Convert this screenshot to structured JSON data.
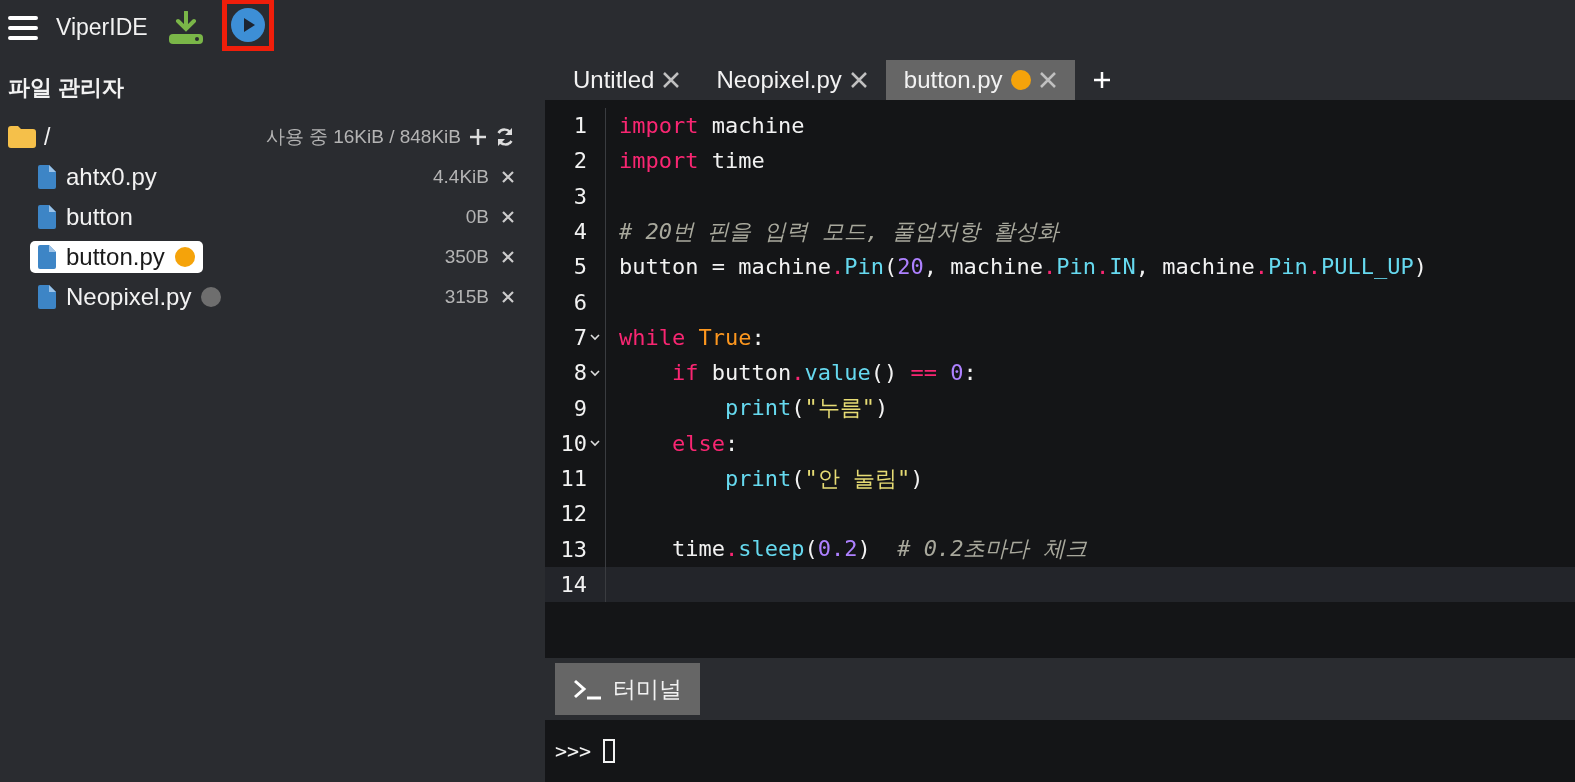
{
  "app": {
    "title": "ViperIDE"
  },
  "file_manager": {
    "title": "파일 관리자",
    "root": {
      "name": "/",
      "usage": "사용 중 16KiB / 848KiB"
    },
    "files": [
      {
        "name": "ahtx0.py",
        "size": "4.4KiB",
        "selected": false
      },
      {
        "name": "button",
        "size": "0B",
        "selected": false
      },
      {
        "name": "button.py",
        "size": "350B",
        "selected": true,
        "color": "#f5a30a"
      },
      {
        "name": "Neopixel.py",
        "size": "315B",
        "selected": false,
        "color": "#6e6e6e"
      }
    ]
  },
  "tabs": [
    {
      "label": "Untitled",
      "selected": false
    },
    {
      "label": "Neopixel.py",
      "selected": false
    },
    {
      "label": "button.py",
      "selected": true,
      "color": "#f5a30a"
    }
  ],
  "editor": {
    "lines": [
      {
        "number": "1",
        "fold": false,
        "current": false,
        "tokens": [
          {
            "kind": "keyword",
            "text": "import"
          },
          {
            "kind": "text",
            "text": " machine"
          }
        ]
      },
      {
        "number": "2",
        "fold": false,
        "current": false,
        "tokens": [
          {
            "kind": "keyword",
            "text": "import"
          },
          {
            "kind": "text",
            "text": " time"
          }
        ]
      },
      {
        "number": "3",
        "fold": false,
        "current": false
      },
      {
        "number": "4",
        "fold": false,
        "current": false,
        "tokens": [
          {
            "kind": "comment",
            "text": "# 20번 핀을 입력 모드, 풀업저항 활성화"
          }
        ]
      },
      {
        "number": "5",
        "fold": false,
        "current": false,
        "tokens": [
          {
            "kind": "text",
            "text": "button = machine"
          },
          {
            "kind": "operator",
            "text": "."
          },
          {
            "kind": "call",
            "text": "Pin"
          },
          {
            "kind": "text",
            "text": "("
          },
          {
            "kind": "number",
            "text": "20"
          },
          {
            "kind": "text",
            "text": ", machine"
          },
          {
            "kind": "operator",
            "text": "."
          },
          {
            "kind": "call",
            "text": "Pin"
          },
          {
            "kind": "operator",
            "text": "."
          },
          {
            "kind": "call",
            "text": "IN"
          },
          {
            "kind": "text",
            "text": ", machine"
          },
          {
            "kind": "operator",
            "text": "."
          },
          {
            "kind": "call",
            "text": "Pin"
          },
          {
            "kind": "operator",
            "text": "."
          },
          {
            "kind": "call",
            "text": "PULL_UP"
          },
          {
            "kind": "text",
            "text": ")"
          }
        ]
      },
      {
        "number": "6",
        "fold": false,
        "current": false
      },
      {
        "number": "7",
        "fold": true,
        "current": false,
        "tokens": [
          {
            "kind": "keyword",
            "text": "while"
          },
          {
            "kind": "constant",
            "text": " True"
          },
          {
            "kind": "text",
            "text": ":"
          }
        ]
      },
      {
        "number": "8",
        "fold": true,
        "current": false,
        "tokens": [
          {
            "kind": "keyword",
            "text": "    if"
          },
          {
            "kind": "text",
            "text": " button"
          },
          {
            "kind": "operator",
            "text": "."
          },
          {
            "kind": "call",
            "text": "value"
          },
          {
            "kind": "text",
            "text": "() "
          },
          {
            "kind": "operator",
            "text": "=="
          },
          {
            "kind": "number",
            "text": " 0"
          },
          {
            "kind": "text",
            "text": ":"
          }
        ]
      },
      {
        "number": "9",
        "fold": false,
        "current": false,
        "tokens": [
          {
            "kind": "call",
            "text": "        print"
          },
          {
            "kind": "text",
            "text": "("
          },
          {
            "kind": "string",
            "text": "\"누름\""
          },
          {
            "kind": "text",
            "text": ")"
          }
        ]
      },
      {
        "number": "10",
        "fold": true,
        "current": false,
        "tokens": [
          {
            "kind": "keyword",
            "text": "    else"
          },
          {
            "kind": "text",
            "text": ":"
          }
        ]
      },
      {
        "number": "11",
        "fold": false,
        "current": false,
        "tokens": [
          {
            "kind": "call",
            "text": "        print"
          },
          {
            "kind": "text",
            "text": "("
          },
          {
            "kind": "string",
            "text": "\"안 눌림\""
          },
          {
            "kind": "text",
            "text": ")"
          }
        ]
      },
      {
        "number": "12",
        "fold": false,
        "current": false
      },
      {
        "number": "13",
        "fold": false,
        "current": false,
        "tokens": [
          {
            "kind": "text",
            "text": "    time"
          },
          {
            "kind": "operator",
            "text": "."
          },
          {
            "kind": "call",
            "text": "sleep"
          },
          {
            "kind": "text",
            "text": "("
          },
          {
            "kind": "number",
            "text": "0.2"
          },
          {
            "kind": "text",
            "text": ")  "
          },
          {
            "kind": "comment",
            "text": "# 0.2초마다 체크"
          }
        ]
      },
      {
        "number": "14",
        "fold": false,
        "current": true
      }
    ]
  },
  "terminal": {
    "tab": "터미널",
    "prompt": ">>>"
  }
}
